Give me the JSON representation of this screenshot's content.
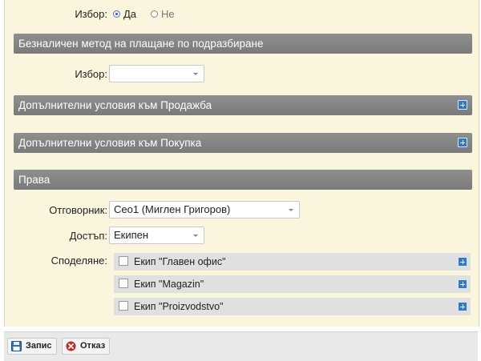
{
  "choice_row": {
    "label": "Избор:",
    "options": [
      {
        "label": "Да",
        "checked": true
      },
      {
        "label": "Не",
        "checked": false
      }
    ]
  },
  "sections": {
    "default_payment": "Безналичен метод на плащане по подразбиране",
    "sale_terms": "Допълнителни условия към Продажба",
    "purchase_terms": "Допълнителни условия към Покупка",
    "rights": "Права"
  },
  "payment_choice": {
    "label": "Избор:",
    "value": ""
  },
  "rights": {
    "owner_label": "Отговорник:",
    "owner_value": "Сео1 (Миглен Григоров)",
    "access_label": "Достъп:",
    "access_value": "Екипен",
    "sharing_label": "Споделяне:",
    "sharing_items": [
      "Екип \"Главен офис\"",
      "Екип \"Magazin\"",
      "Екип \"Proizvodstvo\""
    ]
  },
  "footer": {
    "save_label": "Запис",
    "cancel_label": "Отказ"
  },
  "colors": {
    "panel_bg": "#faf6dd",
    "section_bar": "#858585",
    "accent_blue": "#2f79c8",
    "cancel_red": "#c62828"
  }
}
